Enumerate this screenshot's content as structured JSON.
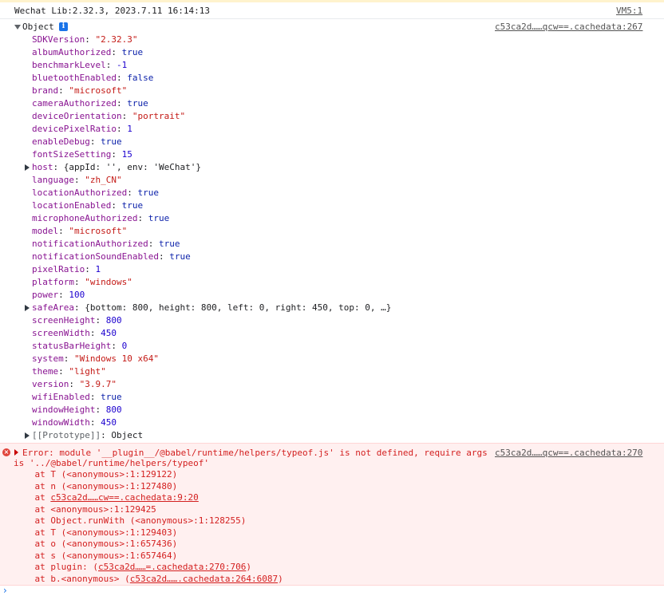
{
  "log_header": {
    "text": "Wechat Lib:2.32.3, 2023.7.11 16:14:13",
    "source": "VM5:1"
  },
  "object": {
    "label": "Object",
    "info_icon": "info-icon",
    "source": "c53ca2d……qcw==.cachedata:267",
    "properties": [
      {
        "key": "SDKVersion",
        "value": "\"2.32.3\"",
        "type": "string"
      },
      {
        "key": "albumAuthorized",
        "value": "true",
        "type": "keyword"
      },
      {
        "key": "benchmarkLevel",
        "value": "-1",
        "type": "number"
      },
      {
        "key": "bluetoothEnabled",
        "value": "false",
        "type": "keyword"
      },
      {
        "key": "brand",
        "value": "\"microsoft\"",
        "type": "string"
      },
      {
        "key": "cameraAuthorized",
        "value": "true",
        "type": "keyword"
      },
      {
        "key": "deviceOrientation",
        "value": "\"portrait\"",
        "type": "string"
      },
      {
        "key": "devicePixelRatio",
        "value": "1",
        "type": "number"
      },
      {
        "key": "enableDebug",
        "value": "true",
        "type": "keyword"
      },
      {
        "key": "fontSizeSetting",
        "value": "15",
        "type": "number"
      },
      {
        "key": "host",
        "value": "{appId: '', env: 'WeChat'}",
        "type": "object"
      },
      {
        "key": "language",
        "value": "\"zh_CN\"",
        "type": "string"
      },
      {
        "key": "locationAuthorized",
        "value": "true",
        "type": "keyword"
      },
      {
        "key": "locationEnabled",
        "value": "true",
        "type": "keyword"
      },
      {
        "key": "microphoneAuthorized",
        "value": "true",
        "type": "keyword"
      },
      {
        "key": "model",
        "value": "\"microsoft\"",
        "type": "string"
      },
      {
        "key": "notificationAuthorized",
        "value": "true",
        "type": "keyword"
      },
      {
        "key": "notificationSoundEnabled",
        "value": "true",
        "type": "keyword"
      },
      {
        "key": "pixelRatio",
        "value": "1",
        "type": "number"
      },
      {
        "key": "platform",
        "value": "\"windows\"",
        "type": "string"
      },
      {
        "key": "power",
        "value": "100",
        "type": "number"
      },
      {
        "key": "safeArea",
        "value": "{bottom: 800, height: 800, left: 0, right: 450, top: 0, …}",
        "type": "object"
      },
      {
        "key": "screenHeight",
        "value": "800",
        "type": "number"
      },
      {
        "key": "screenWidth",
        "value": "450",
        "type": "number"
      },
      {
        "key": "statusBarHeight",
        "value": "0",
        "type": "number"
      },
      {
        "key": "system",
        "value": "\"Windows 10 x64\"",
        "type": "string"
      },
      {
        "key": "theme",
        "value": "\"light\"",
        "type": "string"
      },
      {
        "key": "version",
        "value": "\"3.9.7\"",
        "type": "string"
      },
      {
        "key": "wifiEnabled",
        "value": "true",
        "type": "keyword"
      },
      {
        "key": "windowHeight",
        "value": "800",
        "type": "number"
      },
      {
        "key": "windowWidth",
        "value": "450",
        "type": "number"
      }
    ],
    "prototype_key": "[[Prototype]]",
    "prototype_value": "Object"
  },
  "error": {
    "icon": "error-icon",
    "line1": "Error: module '__plugin__/@babel/runtime/helpers/typeof.js' is not defined, require args",
    "line2": "is '../@babel/runtime/helpers/typeof'",
    "source": "c53ca2d……qcw==.cachedata:270",
    "stack": [
      {
        "prefix": "    at T (<anonymous>:1:129122)",
        "link": "",
        "suffix": ""
      },
      {
        "prefix": "    at n (<anonymous>:1:127480)",
        "link": "",
        "suffix": ""
      },
      {
        "prefix": "    at ",
        "link": "c53ca2d……cw==.cachedata:9:20",
        "suffix": ""
      },
      {
        "prefix": "    at <anonymous>:1:129425",
        "link": "",
        "suffix": ""
      },
      {
        "prefix": "    at Object.runWith (<anonymous>:1:128255)",
        "link": "",
        "suffix": ""
      },
      {
        "prefix": "    at T (<anonymous>:1:129403)",
        "link": "",
        "suffix": ""
      },
      {
        "prefix": "    at o (<anonymous>:1:657436)",
        "link": "",
        "suffix": ""
      },
      {
        "prefix": "    at s (<anonymous>:1:657464)",
        "link": "",
        "suffix": ""
      },
      {
        "prefix": "    at plugin: (",
        "link": "c53ca2d……=.cachedata:270:706",
        "suffix": ")"
      },
      {
        "prefix": "    at b.<anonymous> (",
        "link": "c53ca2d…….cachedata:264:6087",
        "suffix": ")"
      }
    ]
  },
  "prompt": {
    "chevron": "›"
  },
  "colors": {
    "error_bg": "#fff0f0",
    "error_text": "#d31f1f",
    "key": "#881391",
    "string": "#c41a16",
    "number": "#1c00cf",
    "keyword": "#0d22aa"
  }
}
